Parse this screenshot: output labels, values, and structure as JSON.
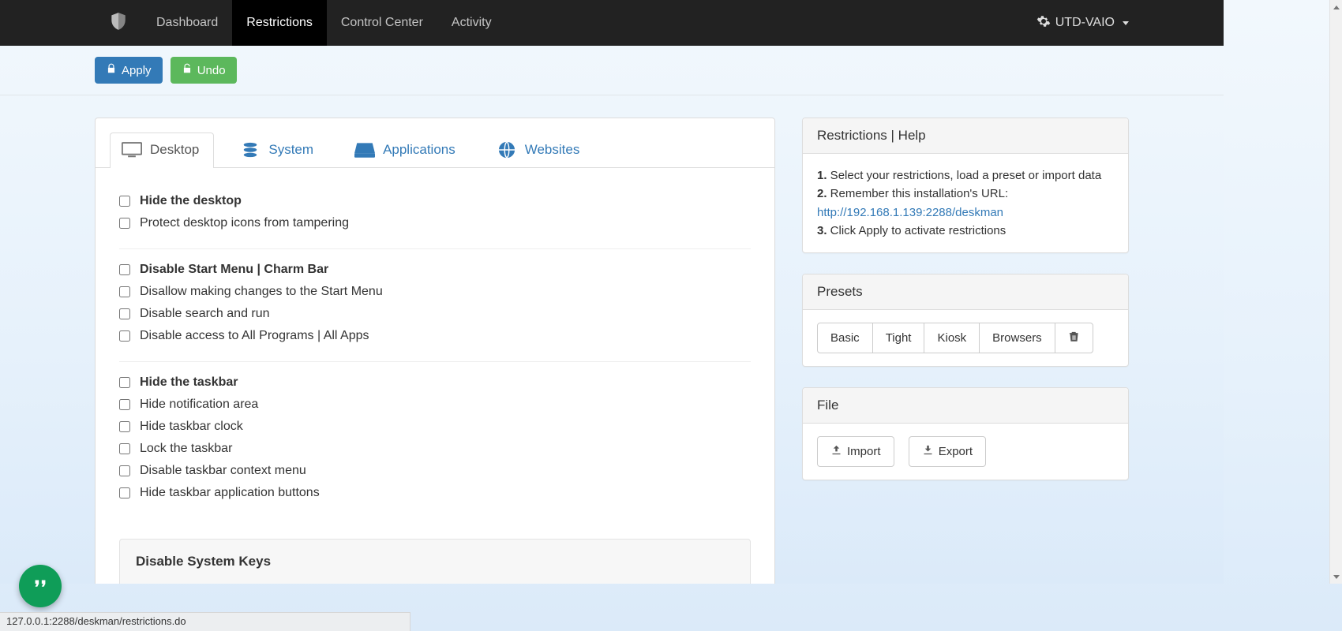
{
  "nav": {
    "items": [
      "Dashboard",
      "Restrictions",
      "Control Center",
      "Activity"
    ],
    "active_index": 1,
    "machine": "UTD-VAIO"
  },
  "actions": {
    "apply": "Apply",
    "undo": "Undo"
  },
  "tabs": {
    "items": [
      "Desktop",
      "System",
      "Applications",
      "Websites"
    ],
    "active_index": 0
  },
  "restrictions": {
    "group1": [
      {
        "label": "Hide the desktop",
        "bold": true,
        "checked": false
      },
      {
        "label": "Protect desktop icons from tampering",
        "bold": false,
        "checked": false
      }
    ],
    "group2": [
      {
        "label": "Disable Start Menu | Charm Bar",
        "bold": true,
        "checked": false
      },
      {
        "label": "Disallow making changes to the Start Menu",
        "bold": false,
        "checked": false
      },
      {
        "label": "Disable search and run",
        "bold": false,
        "checked": false
      },
      {
        "label": "Disable access to All Programs | All Apps",
        "bold": false,
        "checked": false
      }
    ],
    "group3": [
      {
        "label": "Hide the taskbar",
        "bold": true,
        "checked": false
      },
      {
        "label": "Hide notification area",
        "bold": false,
        "checked": false
      },
      {
        "label": "Hide taskbar clock",
        "bold": false,
        "checked": false
      },
      {
        "label": "Lock the taskbar",
        "bold": false,
        "checked": false
      },
      {
        "label": "Disable taskbar context menu",
        "bold": false,
        "checked": false
      },
      {
        "label": "Hide taskbar application buttons",
        "bold": false,
        "checked": false
      }
    ],
    "syskeys_title": "Disable System Keys"
  },
  "help": {
    "title": "Restrictions | Help",
    "step1_num": "1.",
    "step1_txt": " Select your restrictions, load a preset or import data",
    "step2_num": "2.",
    "step2_txt": " Remember this installation's URL:",
    "url": "http://192.168.1.139:2288/deskman",
    "step3_num": "3.",
    "step3_txt": " Click Apply to activate restrictions"
  },
  "presets": {
    "title": "Presets",
    "buttons": [
      "Basic",
      "Tight",
      "Kiosk",
      "Browsers"
    ]
  },
  "file": {
    "title": "File",
    "import": "Import",
    "export": "Export"
  },
  "status_url": "127.0.0.1:2288/deskman/restrictions.do"
}
